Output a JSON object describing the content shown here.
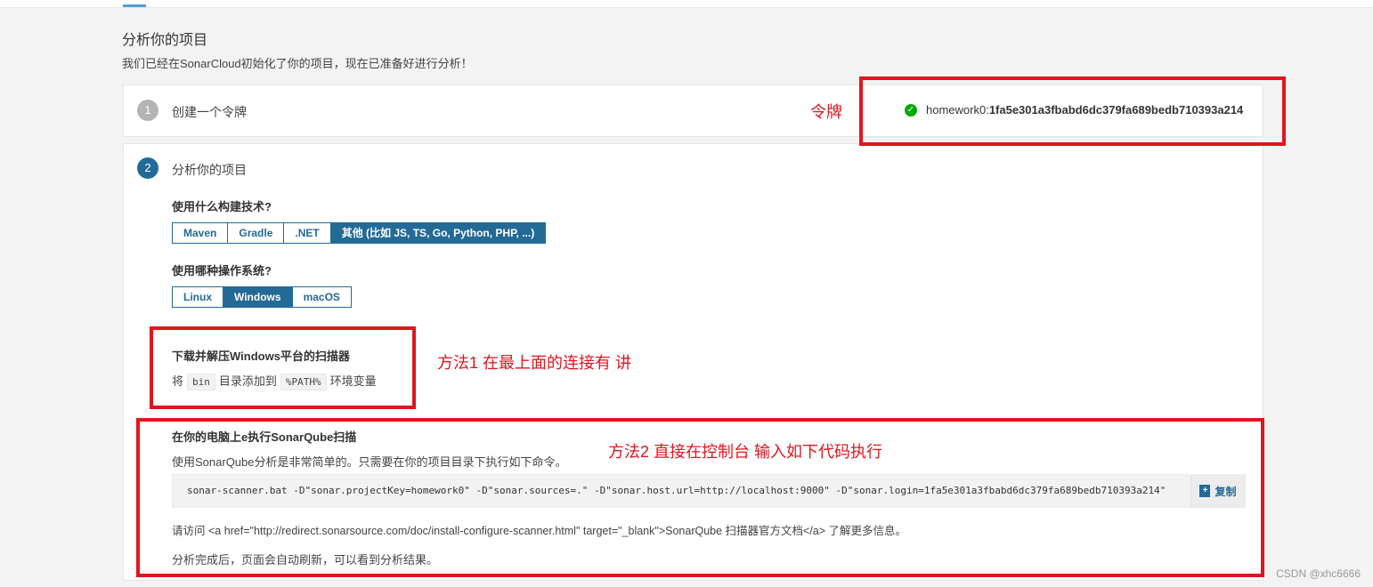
{
  "header": {
    "title": "分析你的项目",
    "subtitle": "我们已经在SonarCloud初始化了你的项目，现在已准备好进行分析！"
  },
  "step1": {
    "number": "1",
    "title": "创建一个令牌",
    "token_prefix": "homework0:",
    "token_value": "1fa5e301a3fbabd6dc379fa689bedb710393a214"
  },
  "step2": {
    "number": "2",
    "title": "分析你的项目",
    "build_question": "使用什么构建技术?",
    "build_options": [
      "Maven",
      "Gradle",
      ".NET",
      "其他 (比如 JS, TS, Go, Python, PHP, ...)"
    ],
    "build_selected": "其他 (比如 JS, TS, Go, Python, PHP, ...)",
    "os_question": "使用哪种操作系统?",
    "os_options": [
      "Linux",
      "Windows",
      "macOS"
    ],
    "os_selected": "Windows",
    "download_title": "下载并解压Windows平台的扫描器",
    "download_text_before": "将",
    "download_code1": "bin",
    "download_text_mid": "目录添加到",
    "download_code2": "%PATH%",
    "download_text_after": "环境变量",
    "run_title": "在你的电脑上e执行SonarQube扫描",
    "run_desc": "使用SonarQube分析是非常简单的。只需要在你的项目目录下执行如下命令。",
    "command": "sonar-scanner.bat -D\"sonar.projectKey=homework0\" -D\"sonar.sources=.\" -D\"sonar.host.url=http://localhost:9000\" -D\"sonar.login=1fa5e301a3fbabd6dc379fa689bedb710393a214\"",
    "copy_label": "复制",
    "visit_text": "请访问 <a href=\"http://redirect.sonarsource.com/doc/install-configure-scanner.html\" target=\"_blank\">SonarQube 扫描器官方文档</a> 了解更多信息。",
    "finish_text": "分析完成后，页面会自动刷新，可以看到分析结果。"
  },
  "annotations": {
    "token": "令牌",
    "method1": "方法1 在最上面的连接有 讲",
    "method2": "方法2 直接在控制台 输入如下代码执行"
  },
  "watermark": "CSDN @xhc6666",
  "colors": {
    "accent": "#236a97",
    "annotation_red": "#e3141e",
    "success_green": "#00aa00"
  }
}
